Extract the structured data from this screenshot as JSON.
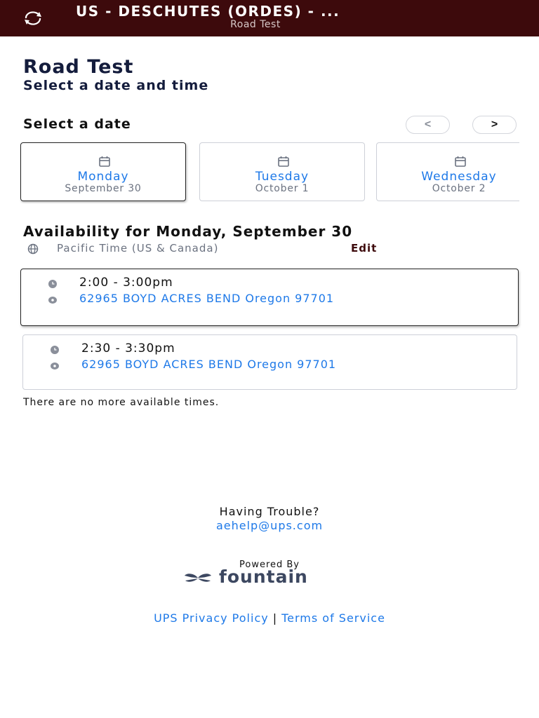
{
  "header": {
    "title": "US - DESCHUTES (ORDES) - ...",
    "subtitle": "Road Test",
    "logo_icon": "rotate-arrows-icon",
    "background_color": "#3d0a0c"
  },
  "page": {
    "title": "Road Test",
    "subtitle": "Select a date and time"
  },
  "date_picker": {
    "label": "Select a date",
    "prev_label": "<",
    "next_label": ">",
    "dates": [
      {
        "day": "Monday",
        "date": "September 30",
        "selected": true
      },
      {
        "day": "Tuesday",
        "date": "October 1",
        "selected": false
      },
      {
        "day": "Wednesday",
        "date": "October 2",
        "selected": false
      }
    ]
  },
  "availability": {
    "title": "Availability for Monday, September 30",
    "timezone": "Pacific Time (US & Canada)",
    "edit_label": "Edit",
    "slots": [
      {
        "time": "2:00 - 3:00pm",
        "address": "62965 BOYD ACRES BEND Oregon 97701",
        "selected": true
      },
      {
        "time": "2:30 - 3:30pm",
        "address": "62965 BOYD ACRES BEND Oregon 97701",
        "selected": false
      }
    ],
    "no_more": "There are no more available times."
  },
  "help": {
    "title": "Having Trouble?",
    "email": "aehelp@ups.com"
  },
  "branding": {
    "powered_by": "Powered By",
    "name": "fountain"
  },
  "footer": {
    "privacy": "UPS Privacy Policy",
    "separator": "|",
    "terms": "Terms of Service"
  },
  "colors": {
    "link": "#1e79e8",
    "accent": "#3d0a0c",
    "muted": "#6b7280"
  }
}
